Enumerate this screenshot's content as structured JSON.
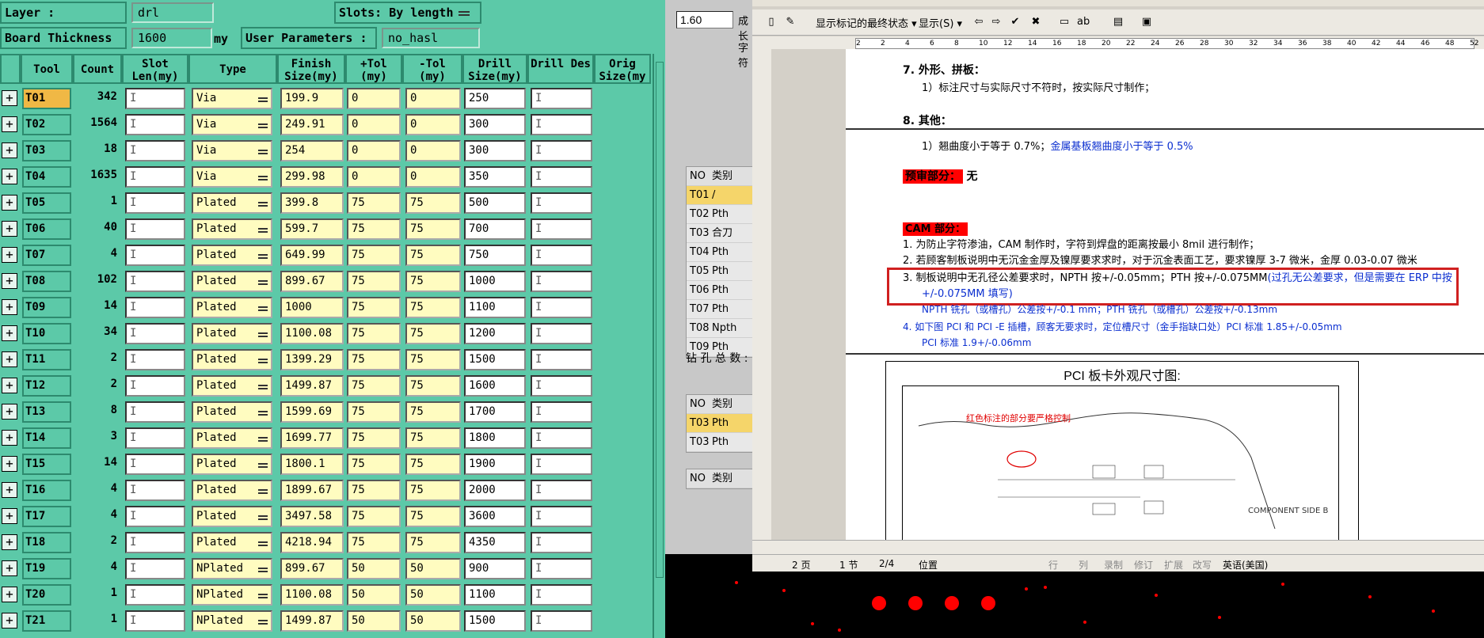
{
  "left_panel": {
    "layer_label": "Layer :",
    "layer_value": "drl",
    "slots_label": "Slots:",
    "slots_value": "By length",
    "board_thickness_label": "Board Thickness :",
    "board_thickness_value": "1600",
    "board_thickness_unit": "my",
    "user_params_label": "User Parameters :",
    "user_params_value": "no_hasl",
    "columns": [
      "Tool",
      "Count",
      "Slot Len(my)",
      "Type",
      "Finish Size(my)",
      "+Tol (my)",
      "-Tol (my)",
      "Drill Size(my)",
      "Drill Des",
      "Orig Size(my"
    ],
    "rows": [
      {
        "tool": "T01",
        "count": "342",
        "type": "Via",
        "finish": "199.9",
        "ptol": "0",
        "mtol": "0",
        "drill": "250"
      },
      {
        "tool": "T02",
        "count": "1564",
        "type": "Via",
        "finish": "249.91",
        "ptol": "0",
        "mtol": "0",
        "drill": "300"
      },
      {
        "tool": "T03",
        "count": "18",
        "type": "Via",
        "finish": "254",
        "ptol": "0",
        "mtol": "0",
        "drill": "300"
      },
      {
        "tool": "T04",
        "count": "1635",
        "type": "Via",
        "finish": "299.98",
        "ptol": "0",
        "mtol": "0",
        "drill": "350"
      },
      {
        "tool": "T05",
        "count": "1",
        "type": "Plated",
        "finish": "399.8",
        "ptol": "75",
        "mtol": "75",
        "drill": "500"
      },
      {
        "tool": "T06",
        "count": "40",
        "type": "Plated",
        "finish": "599.7",
        "ptol": "75",
        "mtol": "75",
        "drill": "700"
      },
      {
        "tool": "T07",
        "count": "4",
        "type": "Plated",
        "finish": "649.99",
        "ptol": "75",
        "mtol": "75",
        "drill": "750"
      },
      {
        "tool": "T08",
        "count": "102",
        "type": "Plated",
        "finish": "899.67",
        "ptol": "75",
        "mtol": "75",
        "drill": "1000"
      },
      {
        "tool": "T09",
        "count": "14",
        "type": "Plated",
        "finish": "1000",
        "ptol": "75",
        "mtol": "75",
        "drill": "1100"
      },
      {
        "tool": "T10",
        "count": "34",
        "type": "Plated",
        "finish": "1100.08",
        "ptol": "75",
        "mtol": "75",
        "drill": "1200"
      },
      {
        "tool": "T11",
        "count": "2",
        "type": "Plated",
        "finish": "1399.29",
        "ptol": "75",
        "mtol": "75",
        "drill": "1500"
      },
      {
        "tool": "T12",
        "count": "2",
        "type": "Plated",
        "finish": "1499.87",
        "ptol": "75",
        "mtol": "75",
        "drill": "1600"
      },
      {
        "tool": "T13",
        "count": "8",
        "type": "Plated",
        "finish": "1599.69",
        "ptol": "75",
        "mtol": "75",
        "drill": "1700"
      },
      {
        "tool": "T14",
        "count": "3",
        "type": "Plated",
        "finish": "1699.77",
        "ptol": "75",
        "mtol": "75",
        "drill": "1800"
      },
      {
        "tool": "T15",
        "count": "14",
        "type": "Plated",
        "finish": "1800.1",
        "ptol": "75",
        "mtol": "75",
        "drill": "1900"
      },
      {
        "tool": "T16",
        "count": "4",
        "type": "Plated",
        "finish": "1899.67",
        "ptol": "75",
        "mtol": "75",
        "drill": "2000"
      },
      {
        "tool": "T17",
        "count": "4",
        "type": "Plated",
        "finish": "3497.58",
        "ptol": "75",
        "mtol": "75",
        "drill": "3600"
      },
      {
        "tool": "T18",
        "count": "2",
        "type": "Plated",
        "finish": "4218.94",
        "ptol": "75",
        "mtol": "75",
        "drill": "4350"
      },
      {
        "tool": "T19",
        "count": "4",
        "type": "NPlated",
        "finish": "899.67",
        "ptol": "50",
        "mtol": "50",
        "drill": "900"
      },
      {
        "tool": "T20",
        "count": "1",
        "type": "NPlated",
        "finish": "1100.08",
        "ptol": "50",
        "mtol": "50",
        "drill": "1100"
      },
      {
        "tool": "T21",
        "count": "1",
        "type": "NPlated",
        "finish": "1499.87",
        "ptol": "50",
        "mtol": "50",
        "drill": "1500"
      }
    ],
    "selected_tool": "T01"
  },
  "middle_panel": {
    "value": "1.60",
    "label_1": "成长",
    "label_2": "字符",
    "table1_header": {
      "no": "NO",
      "type": "类别"
    },
    "table1_rows": [
      {
        "no": "T01",
        "type": "/"
      },
      {
        "no": "T02",
        "type": "Pth"
      },
      {
        "no": "T03",
        "type": "合刀"
      },
      {
        "no": "T04",
        "type": "Pth"
      },
      {
        "no": "T05",
        "type": "Pth"
      },
      {
        "no": "T06",
        "type": "Pth"
      },
      {
        "no": "T07",
        "type": "Pth"
      },
      {
        "no": "T08",
        "type": "Npth"
      },
      {
        "no": "T09",
        "type": "Pth"
      }
    ],
    "total_label": "钻 孔 总 数 :",
    "table2_header": {
      "no": "NO",
      "type": "类别"
    },
    "table2_rows": [
      {
        "no": "T03",
        "type": "Pth"
      },
      {
        "no": "T03",
        "type": "Pth"
      }
    ],
    "table3_header": {
      "no": "NO",
      "type": "类别"
    }
  },
  "word": {
    "toolbar": {
      "markup_mode": "显示标记的最终状态",
      "show_label": "显示(S)"
    },
    "ruler_ticks": [
      "2",
      "2",
      "4",
      "6",
      "8",
      "10",
      "12",
      "14",
      "16",
      "18",
      "20",
      "22",
      "24",
      "26",
      "28",
      "30",
      "32",
      "34",
      "36",
      "38",
      "40",
      "42",
      "44",
      "46",
      "48",
      "52"
    ],
    "doc": {
      "s7_title": "7.   外形、拼板：",
      "s7_line1": "1）标注尺寸与实际尺寸不符时，按实际尺寸制作；",
      "s8_title": "8.   其他：",
      "s8_line1": "1）翘曲度小于等于 0.7%；",
      "s8_line1_blue": "金属基板翘曲度小于等于 0.5%",
      "pre_review_label": "预审部分：",
      "pre_review_value": "无",
      "cam_label": "CAM 部分：",
      "cam1": "1.   为防止字符渗油，CAM 制作时，字符到焊盘的距离按最小 8mil 进行制作；",
      "cam2": "2.   若顾客制板说明中无沉金金厚及镍厚要求求时，对于沉金表面工艺，要求镍厚 3-7 微米，金厚 0.03-0.07 微米",
      "cam3a": "3.   制板说明中无孔径公差要求时，NPTH 按+/-0.05mm；PTH 按+/-0.075MM",
      "cam3a_blue": "(过孔无公差要求，但是需要在 ERP 中按",
      "cam3b_blue": "+/-0.075MM 填写)",
      "cam3c_blue": "NPTH 铣孔（或槽孔）公差按+/-0.1 mm；PTH 铣孔（或槽孔）公差按+/-0.13mm",
      "cam4a_blue": "4.   如下图 PCI 和 PCI -E 插槽，顾客无要求时，定位槽尺寸（金手指缺口处）PCI 标准 1.85+/-0.05mm",
      "cam4b_blue": "PCI 标准 1.9+/-0.06mm",
      "fig_title": "PCI 板卡外观尺寸图:",
      "fig_red": "红色标注的部分要严格控制",
      "fig_comp": "COMPONENT SIDE B"
    },
    "status": {
      "page": "2 页",
      "section": "1 节",
      "pages": "2/4",
      "position": "位置",
      "line": "行",
      "col": "列",
      "rec": "录制",
      "trk": "修订",
      "ext": "扩展",
      "ovr": "改写",
      "lang": "英语(美国)"
    }
  },
  "colors": {
    "panel_teal": "#5cc9a8",
    "selected_tool": "#f0b845",
    "cell_yellow": "#fffcc0",
    "doc_blue": "#0b2fd0",
    "highlight_red": "#ff0000",
    "dots_red": "#ff0000"
  }
}
